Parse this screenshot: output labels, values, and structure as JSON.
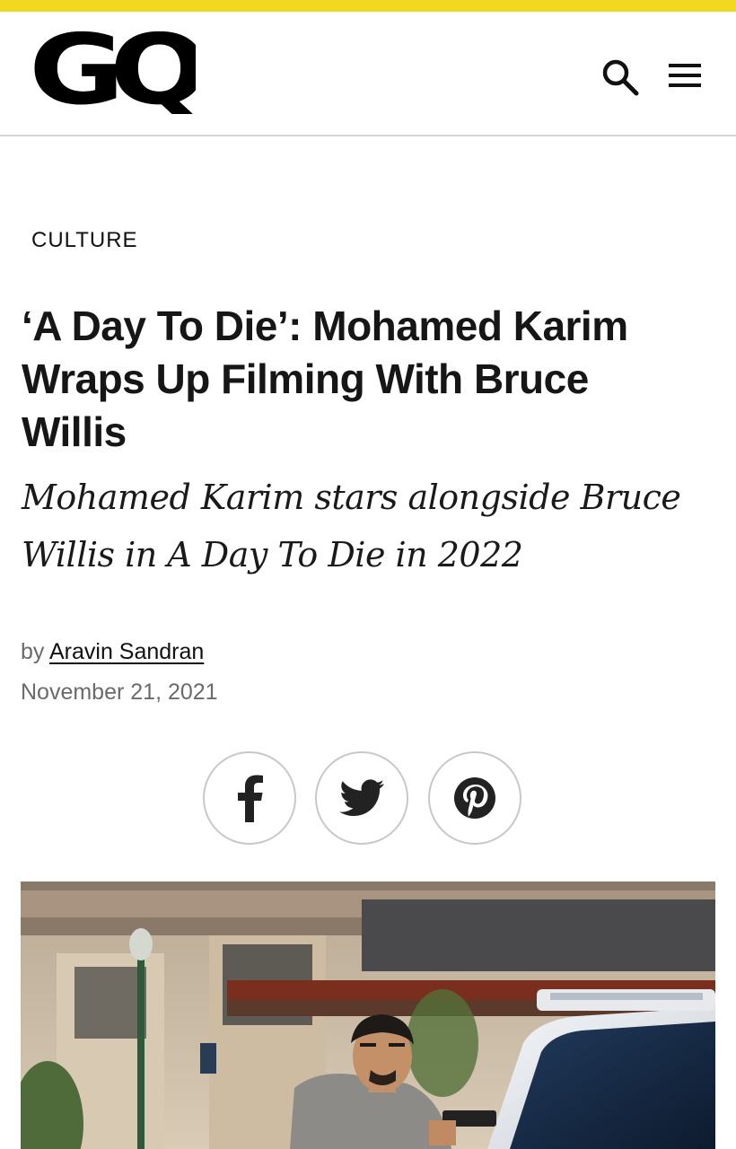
{
  "brand": {
    "accent_color": "#f0d91e",
    "logo_text": "GQ"
  },
  "header": {
    "search_icon": "search-icon",
    "menu_icon": "hamburger-menu-icon"
  },
  "article": {
    "category": "CULTURE",
    "headline_lines": [
      "‘A Day To Die’: Mohamed Karim",
      "Wraps Up Filming With Bruce",
      "Willis"
    ],
    "dek_lines": [
      "Mohamed Karim stars alongside Bruce",
      "Willis in A Day To Die in 2022"
    ],
    "byline_prefix": "by",
    "author": "Aravin Sandran",
    "date": "November 21, 2021"
  },
  "share": {
    "buttons": [
      {
        "name": "facebook",
        "icon": "facebook-icon"
      },
      {
        "name": "twitter",
        "icon": "twitter-icon"
      },
      {
        "name": "pinterest",
        "icon": "pinterest-icon"
      }
    ]
  },
  "hero_image": {
    "description_icon": "hero-photo"
  }
}
